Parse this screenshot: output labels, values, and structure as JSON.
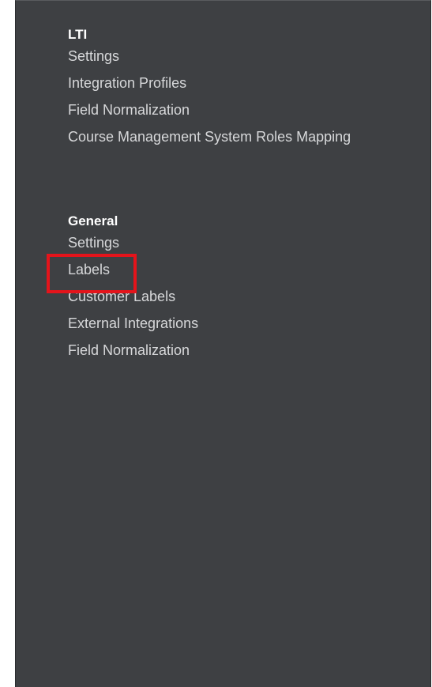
{
  "sidebar": {
    "sections": [
      {
        "heading": "LTI",
        "items": [
          {
            "label": "Settings"
          },
          {
            "label": "Integration Profiles"
          },
          {
            "label": "Field Normalization"
          },
          {
            "label": "Course Management System Roles Mapping"
          }
        ]
      },
      {
        "heading": "General",
        "items": [
          {
            "label": "Settings"
          },
          {
            "label": "Labels",
            "highlighted": true
          },
          {
            "label": "Customer Labels"
          },
          {
            "label": "External Integrations"
          },
          {
            "label": "Field Normalization"
          }
        ]
      }
    ]
  },
  "colors": {
    "panel_background": "#3e4043",
    "heading_text": "#ffffff",
    "item_text": "#d7d8da",
    "highlight": "#e4141b"
  }
}
